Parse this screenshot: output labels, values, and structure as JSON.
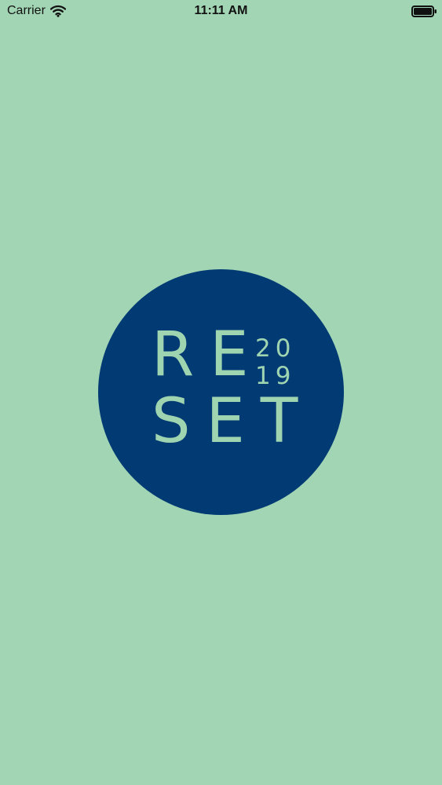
{
  "status_bar": {
    "carrier": "Carrier",
    "time": "11:11 AM",
    "icons": {
      "wifi": "wifi-icon",
      "battery": "battery-icon"
    }
  },
  "logo": {
    "line_1": "RE",
    "line_2": "SET",
    "year_top": "20",
    "year_bottom": "19",
    "colors": {
      "background": "#a2d5b3",
      "circle": "#023a74",
      "text": "#9fd4b1"
    }
  }
}
